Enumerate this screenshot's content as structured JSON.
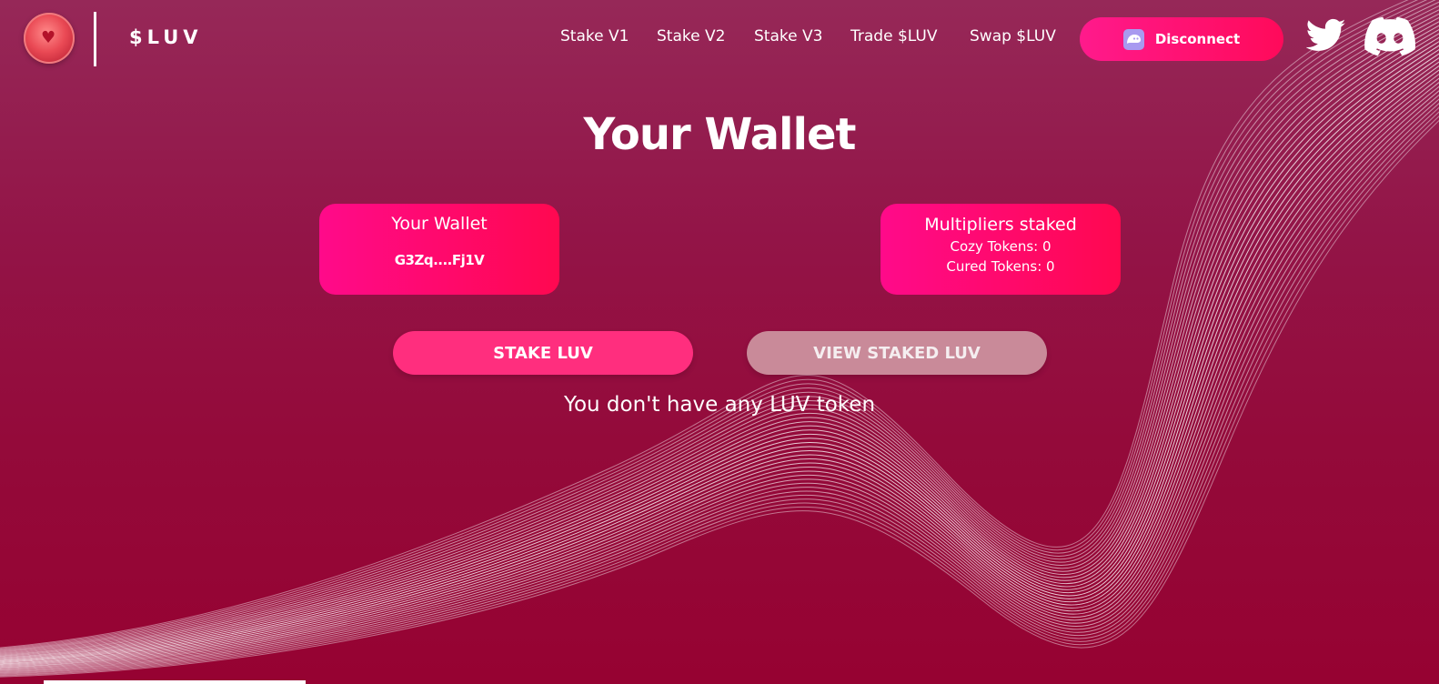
{
  "header": {
    "brand": "$LUV",
    "nav": [
      "Stake V1",
      "Stake V2",
      "Stake V3",
      "Trade $LUV",
      "Swap $LUV"
    ],
    "disconnect_label": "Disconnect",
    "icons": {
      "logo": "luv-logo-icon",
      "wallet": "phantom-wallet-icon",
      "twitter": "twitter-icon",
      "discord": "discord-icon"
    }
  },
  "main": {
    "title": "Your Wallet",
    "wallet_card": {
      "title": "Your Wallet",
      "address": "G3Zq....Fj1V"
    },
    "multipliers_card": {
      "title": "Multipliers staked",
      "cozy": "Cozy Tokens: 0",
      "cured": "Cured Tokens: 0"
    },
    "stake_button": "STAKE LUV",
    "view_button": "VIEW STAKED LUV",
    "empty_message": "You don't have any LUV token"
  },
  "colors": {
    "background_top": "#962858",
    "background_bottom": "#960232",
    "accent_pink": "#ff0a8a",
    "accent_red": "#ff0850",
    "stake_button": "#ff2e7e",
    "view_button_disabled": "#c98a99"
  }
}
